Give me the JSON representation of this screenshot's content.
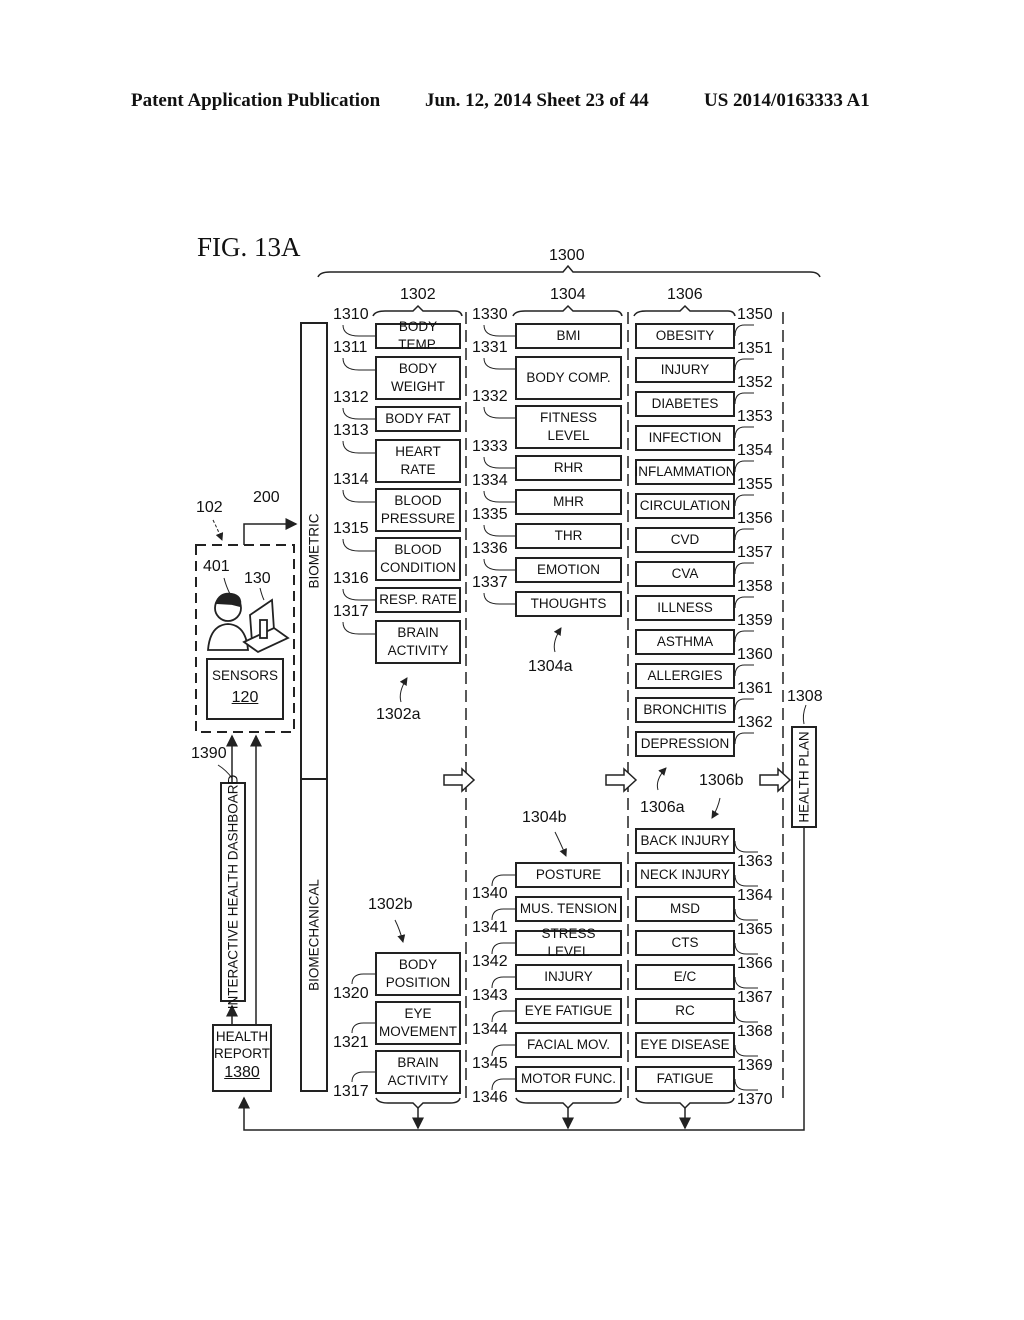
{
  "header": {
    "publication": "Patent Application Publication",
    "date_sheet": "Jun. 12, 2014  Sheet 23 of 44",
    "patent_no": "US 2014/0163333 A1"
  },
  "figure": {
    "title": "FIG. 13A",
    "ref_system": "1300",
    "ref_col1": "1302",
    "ref_col2": "1304",
    "ref_col3": "1306",
    "ref_user_station": "102",
    "ref_link": "200",
    "ref_user": "401",
    "ref_workstation": "130",
    "sensors_label": "SENSORS",
    "sensors_ref": "120",
    "ref_dashboard": "1390",
    "dashboard_label": "INTERACTIVE HEALTH DASHBOARD",
    "report_label_1": "HEALTH",
    "report_label_2": "REPORT",
    "report_ref": "1380",
    "biometric_label": "BIOMETRIC",
    "biomechanical_label": "BIOMECHANICAL",
    "health_plan_label": "HEALTH PLAN",
    "ref_health_plan": "1308",
    "ref_1302a": "1302a",
    "ref_1302b": "1302b",
    "ref_1304a": "1304a",
    "ref_1304b": "1304b",
    "ref_1306a": "1306a",
    "ref_1306b": "1306b"
  },
  "col1_biometric": [
    {
      "ref": "1310",
      "label": "BODY TEMP."
    },
    {
      "ref": "1311",
      "label": "BODY WEIGHT"
    },
    {
      "ref": "1312",
      "label": "BODY FAT"
    },
    {
      "ref": "1313",
      "label": "HEART RATE"
    },
    {
      "ref": "1314",
      "label": "BLOOD PRESSURE"
    },
    {
      "ref": "1315",
      "label": "BLOOD CONDITION"
    },
    {
      "ref": "1316",
      "label": "RESP. RATE"
    },
    {
      "ref": "1317",
      "label": "BRAIN ACTIVITY"
    }
  ],
  "col1_biomechanical": [
    {
      "ref": "1320",
      "label": "BODY POSITION"
    },
    {
      "ref": "1321",
      "label": "EYE MOVEMENT"
    },
    {
      "ref": "1317",
      "label": "BRAIN ACTIVITY"
    }
  ],
  "col2_biometric": [
    {
      "ref": "1330",
      "label": "BMI"
    },
    {
      "ref": "1331",
      "label": "BODY COMP."
    },
    {
      "ref": "1332",
      "label": "FITNESS LEVEL"
    },
    {
      "ref": "1333",
      "label": "RHR"
    },
    {
      "ref": "1334",
      "label": "MHR"
    },
    {
      "ref": "1335",
      "label": "THR"
    },
    {
      "ref": "1336",
      "label": "EMOTION"
    },
    {
      "ref": "1337",
      "label": "THOUGHTS"
    }
  ],
  "col2_biomechanical": [
    {
      "ref": "1340",
      "label": "POSTURE"
    },
    {
      "ref": "1341",
      "label": "MUS. TENSION"
    },
    {
      "ref": "1342",
      "label": "STRESS LEVEL"
    },
    {
      "ref": "1343",
      "label": "INJURY"
    },
    {
      "ref": "1344",
      "label": "EYE FATIGUE"
    },
    {
      "ref": "1345",
      "label": "FACIAL MOV."
    },
    {
      "ref": "1346",
      "label": "MOTOR FUNC."
    }
  ],
  "col3_biometric": [
    {
      "ref": "1350",
      "label": "OBESITY"
    },
    {
      "ref": "1351",
      "label": "INJURY"
    },
    {
      "ref": "1352",
      "label": "DIABETES"
    },
    {
      "ref": "1353",
      "label": "INFECTION"
    },
    {
      "ref": "1354",
      "label": "INFLAMMATION"
    },
    {
      "ref": "1355",
      "label": "CIRCULATION"
    },
    {
      "ref": "1356",
      "label": "CVD"
    },
    {
      "ref": "1357",
      "label": "CVA"
    },
    {
      "ref": "1358",
      "label": "ILLNESS"
    },
    {
      "ref": "1359",
      "label": "ASTHMA"
    },
    {
      "ref": "1360",
      "label": "ALLERGIES"
    },
    {
      "ref": "1361",
      "label": "BRONCHITIS"
    },
    {
      "ref": "1362",
      "label": "DEPRESSION"
    }
  ],
  "col3_biomechanical": [
    {
      "ref": "1363",
      "label": "BACK INJURY"
    },
    {
      "ref": "1364",
      "label": "NECK INJURY"
    },
    {
      "ref": "1365",
      "label": "MSD"
    },
    {
      "ref": "1366",
      "label": "CTS"
    },
    {
      "ref": "1367",
      "label": "E/C"
    },
    {
      "ref": "1368",
      "label": "RC"
    },
    {
      "ref": "1369",
      "label": "EYE DISEASE"
    },
    {
      "ref": "1370",
      "label": "FATIGUE"
    }
  ]
}
